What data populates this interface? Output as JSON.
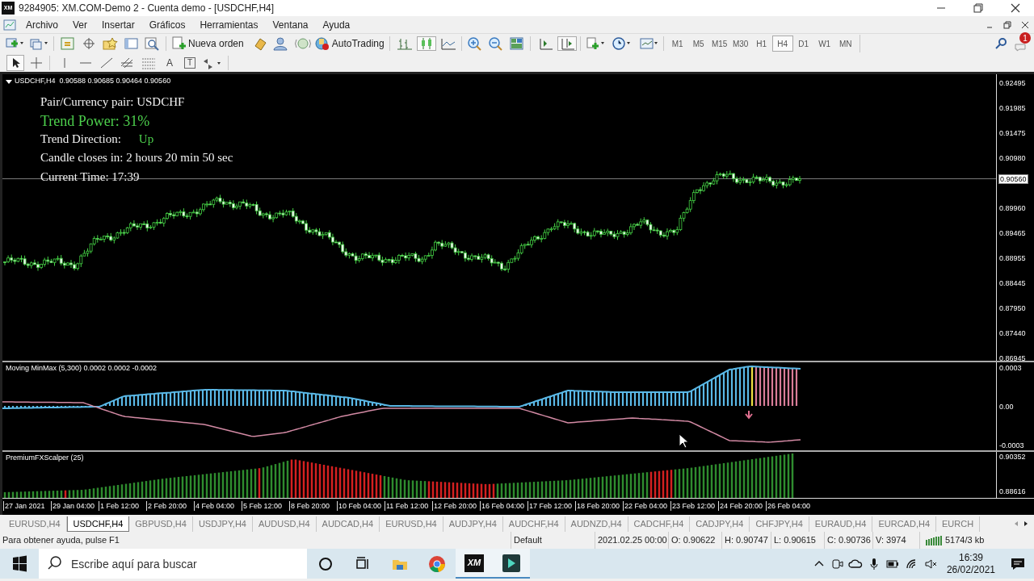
{
  "window": {
    "title": "9284905: XM.COM-Demo 2 - Cuenta demo - [USDCHF,H4]",
    "logo": "XM"
  },
  "menu": [
    "Archivo",
    "Ver",
    "Insertar",
    "Gráficos",
    "Herramientas",
    "Ventana",
    "Ayuda"
  ],
  "toolbar": {
    "new_order": "Nueva orden",
    "autotrading": "AutoTrading",
    "notifications": "1",
    "timeframes": [
      {
        "label": "M1",
        "selected": false
      },
      {
        "label": "M5",
        "selected": false
      },
      {
        "label": "M15",
        "selected": false
      },
      {
        "label": "M30",
        "selected": false
      },
      {
        "label": "H1",
        "selected": false
      },
      {
        "label": "H4",
        "selected": true
      },
      {
        "label": "D1",
        "selected": false
      },
      {
        "label": "W1",
        "selected": false
      },
      {
        "label": "MN",
        "selected": false
      }
    ]
  },
  "drawing_toolbar": {
    "text_glyph": "A",
    "label_glyph": "T"
  },
  "chart": {
    "header": "USDCHF,H4  0.90588 0.90685 0.90464 0.90560",
    "info": [
      {
        "kind": "plain",
        "text": "Pair/Currency pair: USDCHF"
      },
      {
        "kind": "power",
        "text": "Trend Power: 31%"
      },
      {
        "kind": "direction",
        "text": "Trend Direction:",
        "value": "Up"
      },
      {
        "kind": "plain",
        "text": "Candle closes in: 2 hours 20 min 50 sec"
      },
      {
        "kind": "plain",
        "text": "Current Time: 17:39"
      }
    ],
    "price_axis": [
      "0.92495",
      "0.91985",
      "0.91475",
      "0.90980",
      "0.89960",
      "0.89465",
      "0.88955",
      "0.88445",
      "0.87950",
      "0.87440",
      "0.86945"
    ],
    "current_price": "0.90560"
  },
  "indicators": [
    {
      "title": "Moving MinMax (5,300) 0.0002 0.0002 -0.0002",
      "axis": [
        "0.0003",
        "0.00",
        "-0.0003"
      ]
    },
    {
      "title": "PremiumFXScalper (25)",
      "axis": [
        "0.90352",
        "0.88616"
      ]
    }
  ],
  "time_axis": [
    "27 Jan 2021",
    "29 Jan 04:00",
    "1 Feb 12:00",
    "2 Feb 20:00",
    "4 Feb 04:00",
    "5 Feb 12:00",
    "8 Feb 20:00",
    "10 Feb 04:00",
    "11 Feb 12:00",
    "12 Feb 20:00",
    "16 Feb 04:00",
    "17 Feb 12:00",
    "18 Feb 20:00",
    "22 Feb 04:00",
    "23 Feb 12:00",
    "24 Feb 20:00",
    "26 Feb 04:00"
  ],
  "chart_tabs": [
    {
      "label": "EURUSD,H4",
      "selected": false
    },
    {
      "label": "USDCHF,H4",
      "selected": true
    },
    {
      "label": "GBPUSD,H4",
      "selected": false
    },
    {
      "label": "USDJPY,H4",
      "selected": false
    },
    {
      "label": "AUDUSD,H4",
      "selected": false
    },
    {
      "label": "AUDCAD,H4",
      "selected": false
    },
    {
      "label": "EURUSD,H4",
      "selected": false
    },
    {
      "label": "AUDJPY,H4",
      "selected": false
    },
    {
      "label": "AUDCHF,H4",
      "selected": false
    },
    {
      "label": "AUDNZD,H4",
      "selected": false
    },
    {
      "label": "CADCHF,H4",
      "selected": false
    },
    {
      "label": "CADJPY,H4",
      "selected": false
    },
    {
      "label": "CHFJPY,H4",
      "selected": false
    },
    {
      "label": "EURAUD,H4",
      "selected": false
    },
    {
      "label": "EURCAD,H4",
      "selected": false
    },
    {
      "label": "EURCH",
      "selected": false
    }
  ],
  "status_bar": {
    "help": "Para obtener ayuda, pulse F1",
    "profile": "Default",
    "datetime": "2021.02.25 00:00",
    "open": "O: 0.90622",
    "high": "H: 0.90747",
    "low": "L: 0.90615",
    "close": "C: 0.90736",
    "volume": "V: 3974",
    "traffic": "5174/3 kb"
  },
  "taskbar": {
    "search_placeholder": "Escribe aquí para buscar",
    "time": "16:39",
    "date": "26/02/2021",
    "apps": [
      {
        "kind": "cortana",
        "selected": false
      },
      {
        "kind": "taskview",
        "selected": false
      },
      {
        "kind": "explorer",
        "selected": false
      },
      {
        "kind": "chrome",
        "selected": false
      },
      {
        "kind": "xm",
        "label": "XM",
        "selected": true
      },
      {
        "kind": "editor",
        "selected": true
      }
    ]
  }
}
